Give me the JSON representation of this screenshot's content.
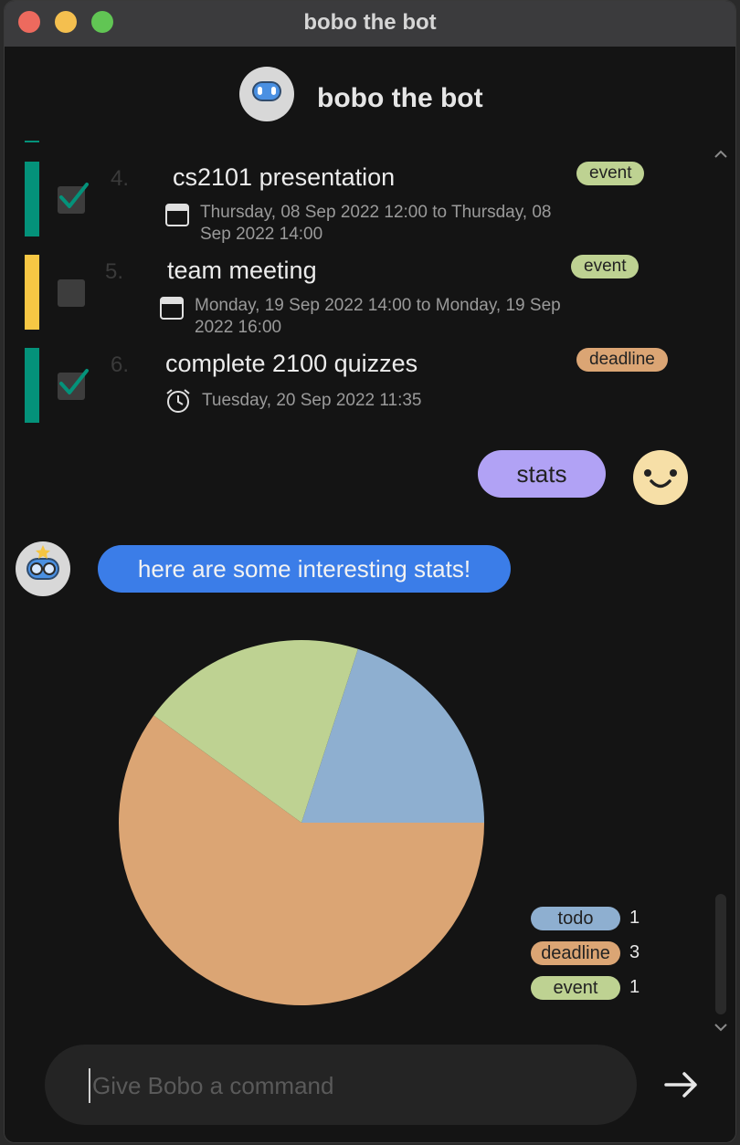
{
  "window": {
    "title": "bobo the bot"
  },
  "header": {
    "name": "bobo the bot"
  },
  "tasks": [
    {
      "number": "4.",
      "title": "cs2101 presentation",
      "tag": "event",
      "done": true,
      "date": "Thursday, 08 Sep 2022 12:00 to Thursday, 08 Sep 2022 14:00",
      "date_icon": "calendar-icon",
      "color": "#04927a"
    },
    {
      "number": "5.",
      "title": "team meeting",
      "tag": "event",
      "done": false,
      "date": "Monday, 19 Sep 2022 14:00 to Monday, 19 Sep 2022 16:00",
      "date_icon": "calendar-icon",
      "color": "#f7c744"
    },
    {
      "number": "6.",
      "title": "complete 2100 quizzes",
      "tag": "deadline",
      "done": true,
      "date": "Tuesday, 20 Sep 2022 11:35",
      "date_icon": "alarm-clock-icon",
      "color": "#04927a"
    }
  ],
  "user_message": "stats",
  "bot_message": "here are some interesting stats!",
  "stats_legend": [
    {
      "label": "todo",
      "count": "1",
      "color": "#8eafd0"
    },
    {
      "label": "deadline",
      "count": "3",
      "color": "#dba574"
    },
    {
      "label": "event",
      "count": "1",
      "color": "#bed292"
    }
  ],
  "chart_data": {
    "type": "pie",
    "categories": [
      "todo",
      "deadline",
      "event"
    ],
    "values": [
      1,
      3,
      1
    ],
    "colors": [
      "#8eafd0",
      "#dba574",
      "#bed292"
    ]
  },
  "input": {
    "placeholder": "Give Bobo a command",
    "value": ""
  },
  "colors": {
    "background": "#141414",
    "accent_user": "#b1a2f5",
    "accent_bot": "#3b7de8",
    "done_bar": "#04927a",
    "pending_bar": "#f7c744"
  }
}
